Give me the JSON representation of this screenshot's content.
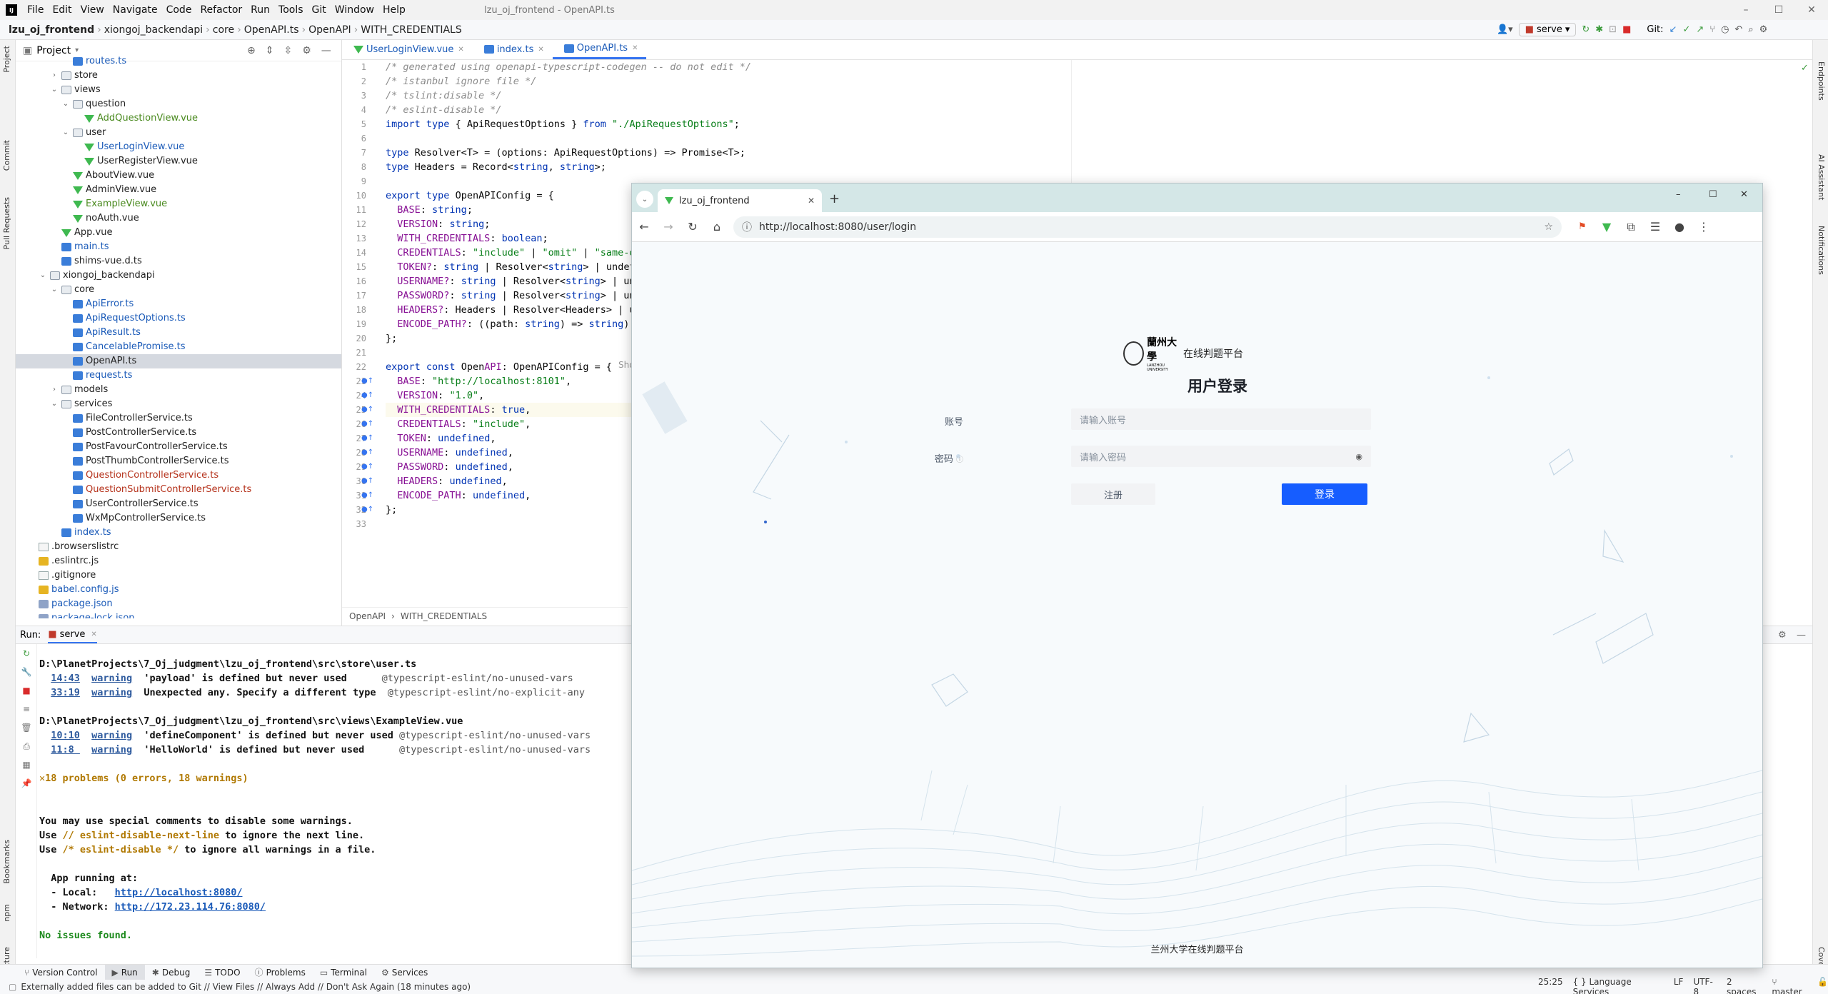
{
  "ide": {
    "app_icon": "IJ",
    "menu": [
      "File",
      "Edit",
      "View",
      "Navigate",
      "Code",
      "Refactor",
      "Run",
      "Tools",
      "Git",
      "Window",
      "Help"
    ],
    "window_title": "lzu_oj_frontend - OpenAPI.ts",
    "breadcrumb": [
      "lzu_oj_frontend",
      "xiongoj_backendapi",
      "core",
      "OpenAPI.ts",
      "OpenAPI",
      "WITH_CREDENTIALS"
    ],
    "run_config": "serve",
    "git_label": "Git:",
    "project_label": "Project",
    "left_strip": [
      "Project",
      "Commit",
      "Pull Requests",
      "Bookmarks",
      "npm",
      "Structure"
    ],
    "right_strip": [
      "Endpoints",
      "AI Assistant",
      "Notifications",
      "Coverage"
    ]
  },
  "tree": [
    {
      "label": "routes.ts",
      "depth": 4,
      "icon": "ts",
      "color": "blue",
      "chev": ""
    },
    {
      "label": "store",
      "depth": 3,
      "icon": "folder",
      "color": "dark",
      "chev": "›"
    },
    {
      "label": "views",
      "depth": 3,
      "icon": "folder",
      "color": "dark",
      "chev": "⌄"
    },
    {
      "label": "question",
      "depth": 4,
      "icon": "folder",
      "color": "dark",
      "chev": "⌄"
    },
    {
      "label": "AddQuestionView.vue",
      "depth": 5,
      "icon": "vue",
      "color": "green",
      "chev": ""
    },
    {
      "label": "user",
      "depth": 4,
      "icon": "folder",
      "color": "dark",
      "chev": "⌄"
    },
    {
      "label": "UserLoginView.vue",
      "depth": 5,
      "icon": "vue",
      "color": "blue",
      "chev": ""
    },
    {
      "label": "UserRegisterView.vue",
      "depth": 5,
      "icon": "vue",
      "color": "dark",
      "chev": ""
    },
    {
      "label": "AboutView.vue",
      "depth": 4,
      "icon": "vue",
      "color": "dark",
      "chev": ""
    },
    {
      "label": "AdminView.vue",
      "depth": 4,
      "icon": "vue",
      "color": "dark",
      "chev": ""
    },
    {
      "label": "ExampleView.vue",
      "depth": 4,
      "icon": "vue",
      "color": "green",
      "chev": ""
    },
    {
      "label": "noAuth.vue",
      "depth": 4,
      "icon": "vue",
      "color": "dark",
      "chev": ""
    },
    {
      "label": "App.vue",
      "depth": 3,
      "icon": "vue",
      "color": "dark",
      "chev": ""
    },
    {
      "label": "main.ts",
      "depth": 3,
      "icon": "ts",
      "color": "blue",
      "chev": ""
    },
    {
      "label": "shims-vue.d.ts",
      "depth": 3,
      "icon": "ts",
      "color": "dark",
      "chev": ""
    },
    {
      "label": "xiongoj_backendapi",
      "depth": 2,
      "icon": "folder",
      "color": "dark",
      "chev": "⌄"
    },
    {
      "label": "core",
      "depth": 3,
      "icon": "folder",
      "color": "dark",
      "chev": "⌄"
    },
    {
      "label": "ApiError.ts",
      "depth": 4,
      "icon": "ts",
      "color": "blue",
      "chev": ""
    },
    {
      "label": "ApiRequestOptions.ts",
      "depth": 4,
      "icon": "ts",
      "color": "blue",
      "chev": ""
    },
    {
      "label": "ApiResult.ts",
      "depth": 4,
      "icon": "ts",
      "color": "blue",
      "chev": ""
    },
    {
      "label": "CancelablePromise.ts",
      "depth": 4,
      "icon": "ts",
      "color": "blue",
      "chev": ""
    },
    {
      "label": "OpenAPI.ts",
      "depth": 4,
      "icon": "ts",
      "color": "dark",
      "chev": "",
      "selected": true
    },
    {
      "label": "request.ts",
      "depth": 4,
      "icon": "ts",
      "color": "blue",
      "chev": ""
    },
    {
      "label": "models",
      "depth": 3,
      "icon": "folder",
      "color": "dark",
      "chev": "›"
    },
    {
      "label": "services",
      "depth": 3,
      "icon": "folder",
      "color": "dark",
      "chev": "⌄"
    },
    {
      "label": "FileControllerService.ts",
      "depth": 4,
      "icon": "ts",
      "color": "dark",
      "chev": ""
    },
    {
      "label": "PostControllerService.ts",
      "depth": 4,
      "icon": "ts",
      "color": "dark",
      "chev": ""
    },
    {
      "label": "PostFavourControllerService.ts",
      "depth": 4,
      "icon": "ts",
      "color": "dark",
      "chev": ""
    },
    {
      "label": "PostThumbControllerService.ts",
      "depth": 4,
      "icon": "ts",
      "color": "dark",
      "chev": ""
    },
    {
      "label": "QuestionControllerService.ts",
      "depth": 4,
      "icon": "ts",
      "color": "red",
      "chev": ""
    },
    {
      "label": "QuestionSubmitControllerService.ts",
      "depth": 4,
      "icon": "ts",
      "color": "red",
      "chev": ""
    },
    {
      "label": "UserControllerService.ts",
      "depth": 4,
      "icon": "ts",
      "color": "dark",
      "chev": ""
    },
    {
      "label": "WxMpControllerService.ts",
      "depth": 4,
      "icon": "ts",
      "color": "dark",
      "chev": ""
    },
    {
      "label": "index.ts",
      "depth": 3,
      "icon": "ts",
      "color": "blue",
      "chev": ""
    },
    {
      "label": ".browserslistrc",
      "depth": 1,
      "icon": "file",
      "color": "dark",
      "chev": ""
    },
    {
      "label": ".eslintrc.js",
      "depth": 1,
      "icon": "js",
      "color": "dark",
      "chev": ""
    },
    {
      "label": ".gitignore",
      "depth": 1,
      "icon": "file",
      "color": "dark",
      "chev": ""
    },
    {
      "label": "babel.config.js",
      "depth": 1,
      "icon": "js",
      "color": "blue",
      "chev": ""
    },
    {
      "label": "package.json",
      "depth": 1,
      "icon": "json",
      "color": "blue",
      "chev": ""
    },
    {
      "label": "package-lock.json",
      "depth": 1,
      "icon": "json",
      "color": "blue",
      "chev": ""
    }
  ],
  "editor_tabs": [
    "UserLoginView.vue",
    "index.ts",
    "OpenAPI.ts"
  ],
  "line_numbers": [
    "1",
    "2",
    "3",
    "4",
    "5",
    "6",
    "7",
    "8",
    "9",
    "10",
    "11",
    "12",
    "13",
    "14",
    "15",
    "16",
    "17",
    "18",
    "19",
    "20",
    "21",
    "22",
    "23",
    "24",
    "25",
    "26",
    "27",
    "28",
    "29",
    "30",
    "31",
    "32",
    "33"
  ],
  "code_lines": [
    "/* generated using openapi-typescript-codegen -- do not edit */",
    "/* istanbul ignore file */",
    "/* tslint:disable */",
    "/* eslint-disable */",
    "import type { ApiRequestOptions } from \"./ApiRequestOptions\";",
    "",
    "type Resolver<T> = (options: ApiRequestOptions) => Promise<T>;",
    "type Headers = Record<string, string>;",
    "",
    "export type OpenAPIConfig = {",
    "  BASE: string;",
    "  VERSION: string;",
    "  WITH_CREDENTIALS: boolean;",
    "  CREDENTIALS: \"include\" | \"omit\" | \"same-o",
    "  TOKEN?: string | Resolver<string> | undef",
    "  USERNAME?: string | Resolver<string> | un",
    "  PASSWORD?: string | Resolver<string> | un",
    "  HEADERS?: Headers | Resolver<Headers> | u",
    "  ENCODE_PATH?: ((path: string) => string)",
    "};",
    "",
    "export const OpenAPI: OpenAPIConfig = {",
    "  BASE: \"http://localhost:8101\",",
    "  VERSION: \"1.0\",",
    "  WITH_CREDENTIALS: true,",
    "  CREDENTIALS: \"include\",",
    "  TOKEN: undefined,",
    "  USERNAME: undefined,",
    "  PASSWORD: undefined,",
    "  HEADERS: undefined,",
    "  ENCODE_PATH: undefined,",
    "};",
    ""
  ],
  "inline_hint": "Sho",
  "editor_breadcrumb": [
    "OpenAPI",
    "WITH_CREDENTIALS"
  ],
  "run": {
    "label": "Run:",
    "tab": "serve",
    "console": [
      {
        "t": "D:\\PlanetProjects\\7_Oj_judgment\\lzu_oj_frontend\\src\\store\\user.ts",
        "k": "path"
      },
      {
        "pos": "14:43",
        "lvl": "warning",
        "msg": "'payload' is defined but never used      ",
        "rule": "@typescript-eslint/no-unused-vars",
        "k": "warn"
      },
      {
        "pos": "33:19",
        "lvl": "warning",
        "msg": "Unexpected any. Specify a different type  ",
        "rule": "@typescript-eslint/no-explicit-any",
        "k": "warn"
      },
      {
        "t": "",
        "k": "blank"
      },
      {
        "t": "D:\\PlanetProjects\\7_Oj_judgment\\lzu_oj_frontend\\src\\views\\ExampleView.vue",
        "k": "path"
      },
      {
        "pos": "10:10",
        "lvl": "warning",
        "msg": "'defineComponent' is defined but never used ",
        "rule": "@typescript-eslint/no-unused-vars",
        "k": "warn"
      },
      {
        "pos": "11:8 ",
        "lvl": "warning",
        "msg": "'HelloWorld' is defined but never used      ",
        "rule": "@typescript-eslint/no-unused-vars",
        "k": "warn"
      },
      {
        "t": "",
        "k": "blank"
      },
      {
        "t": "✕18 problems (0 errors, 18 warnings)",
        "k": "problems"
      },
      {
        "t": "",
        "k": "blank"
      },
      {
        "t": "",
        "k": "blank"
      },
      {
        "t": "You may use special comments to disable some warnings.",
        "k": "plain"
      },
      {
        "pre": "Use ",
        "code": "// eslint-disable-next-line",
        "post": " to ignore the next line.",
        "k": "hint"
      },
      {
        "pre": "Use ",
        "code": "/* eslint-disable */",
        "post": " to ignore all warnings in a file.",
        "k": "hint"
      },
      {
        "t": "",
        "k": "blank"
      },
      {
        "t": "  App running at:",
        "k": "plain"
      },
      {
        "pre": "  - Local:   ",
        "url": "http://localhost:8080/",
        "k": "url"
      },
      {
        "pre": "  - Network: ",
        "url": "http://172.23.114.76:8080/",
        "k": "url"
      },
      {
        "t": "",
        "k": "blank"
      },
      {
        "t": "No issues found.",
        "k": "ok"
      }
    ]
  },
  "bottom_tools": [
    "Version Control",
    "Run",
    "Debug",
    "TODO",
    "Problems",
    "Terminal",
    "Services"
  ],
  "status": {
    "message": "Externally added files can be added to Git // View Files // Always Add // Don't Ask Again (18 minutes ago)",
    "position": "25:25",
    "lang": "Language Services",
    "eol": "LF",
    "encoding": "UTF-8",
    "indent": "2 spaces",
    "branch": "master"
  },
  "browser": {
    "tab_title": "lzu_oj_frontend",
    "url": "http://localhost:8080/user/login",
    "logo_text": "蘭州大學",
    "logo_sub": "LANZHOU UNIVERSITY",
    "site_name": "在线判题平台",
    "login_title": "用户登录",
    "account_label": "账号",
    "account_placeholder": "请输入账号",
    "password_label": "密码",
    "password_placeholder": "请输入密码",
    "register_button": "注册",
    "login_button": "登录",
    "footer": "兰州大学在线判题平台"
  }
}
